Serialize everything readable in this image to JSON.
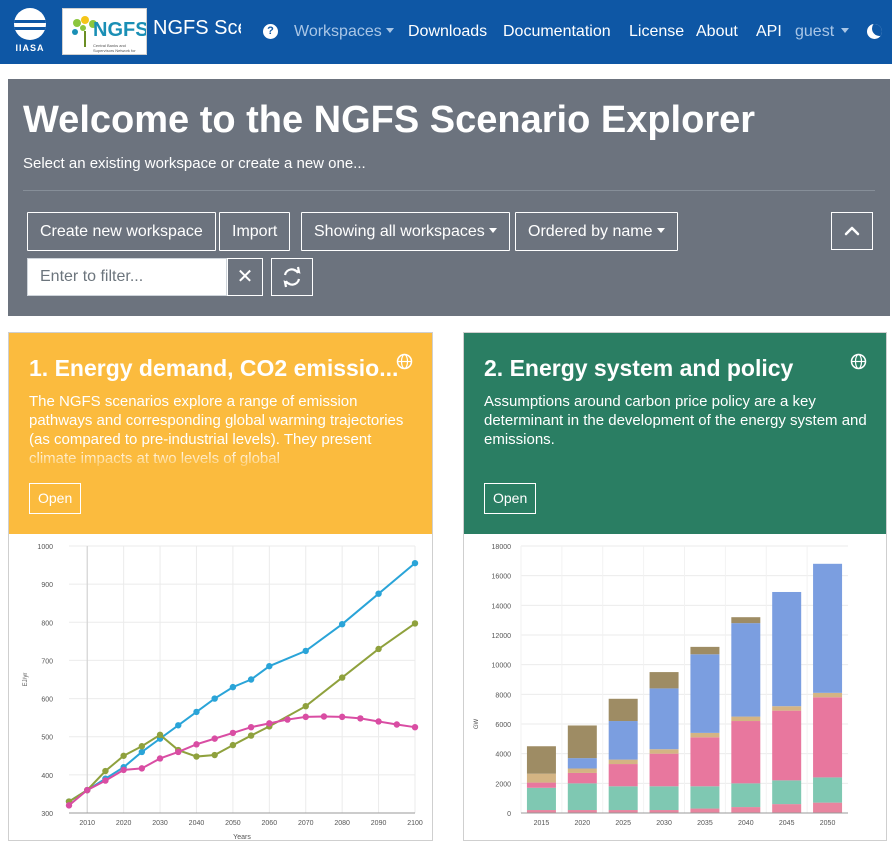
{
  "navbar": {
    "iiasa_logo_text": "IIASA",
    "ngfs_logo_text": "NGFS",
    "ngfs_logo_sub": "Central Banks and Supervisors Network for Greening the Financial System",
    "brand": "NGFS Scenario Explorer",
    "items": [
      {
        "label": "Workspaces",
        "muted": true,
        "dropdown": true
      },
      {
        "label": "Downloads"
      },
      {
        "label": "Documentation"
      },
      {
        "label": "License"
      },
      {
        "label": "About"
      },
      {
        "label": "API"
      },
      {
        "label": "guest",
        "muted": true,
        "dropdown": true
      }
    ],
    "help_icon": "question-circle-icon",
    "theme_icon": "moon-icon",
    "colors": {
      "background": "#0e57a5"
    }
  },
  "jumbotron": {
    "title": "Welcome to the NGFS Scenario Explorer",
    "lead": "Select an existing workspace or create a new one...",
    "buttons": {
      "create": "Create new workspace",
      "import": "Import",
      "showing": "Showing all workspaces",
      "ordered": "Ordered by name"
    },
    "filter_placeholder": "Enter to filter...",
    "colors": {
      "background": "#6c737e"
    }
  },
  "cards": [
    {
      "title": "1. Energy demand, CO2 emissio...",
      "description": "The NGFS scenarios explore a range of emission pathways and corresponding global warming trajectories (as compared to pre-industrial levels). They present climate impacts at two levels of global",
      "open_label": "Open",
      "color": "#fbbb3e"
    },
    {
      "title": "2. Energy system and policy",
      "description": "Assumptions around carbon price policy are a key determinant in the development of the energy system and emissions.",
      "open_label": "Open",
      "color": "#2a7e63"
    }
  ],
  "chart_data": [
    {
      "type": "line",
      "xlabel": "Years",
      "ylabel": "EJ/yr",
      "ylim": [
        300,
        1000
      ],
      "xlim": [
        2005,
        2100
      ],
      "y_ticks": [
        300,
        400,
        500,
        600,
        700,
        800,
        900,
        1000
      ],
      "x_ticks": [
        2010,
        2020,
        2030,
        2040,
        2050,
        2060,
        2070,
        2080,
        2090,
        2100
      ],
      "grid": true,
      "series": [
        {
          "color": "#2aa4d8",
          "x": [
            2005,
            2010,
            2015,
            2020,
            2025,
            2030,
            2035,
            2040,
            2045,
            2050,
            2055,
            2060,
            2070,
            2080,
            2090,
            2100
          ],
          "y": [
            330,
            360,
            390,
            420,
            460,
            495,
            530,
            565,
            600,
            630,
            650,
            685,
            725,
            795,
            875,
            955
          ]
        },
        {
          "color": "#8fa13d",
          "x": [
            2005,
            2010,
            2015,
            2020,
            2025,
            2030,
            2035,
            2040,
            2045,
            2050,
            2055,
            2060,
            2070,
            2080,
            2090,
            2100
          ],
          "y": [
            330,
            360,
            410,
            450,
            475,
            505,
            465,
            448,
            452,
            478,
            503,
            527,
            580,
            655,
            730,
            797
          ]
        },
        {
          "color": "#d94da3",
          "x": [
            2005,
            2010,
            2015,
            2020,
            2025,
            2030,
            2035,
            2040,
            2045,
            2050,
            2055,
            2060,
            2065,
            2070,
            2075,
            2080,
            2085,
            2090,
            2095,
            2100
          ],
          "y": [
            320,
            360,
            385,
            413,
            417,
            443,
            460,
            480,
            495,
            510,
            525,
            535,
            545,
            552,
            553,
            552,
            548,
            540,
            532,
            525
          ]
        }
      ]
    },
    {
      "type": "bar",
      "stacked": true,
      "xlabel": "",
      "ylabel": "GW",
      "ylim": [
        0,
        18000
      ],
      "y_ticks": [
        0,
        2000,
        4000,
        6000,
        8000,
        10000,
        12000,
        14000,
        16000,
        18000
      ],
      "categories": [
        "2015",
        "2020",
        "2025",
        "2030",
        "2035",
        "2040",
        "2045",
        "2050"
      ],
      "grid": true,
      "series": [
        {
          "color": "#e8859f",
          "values": [
            200,
            200,
            200,
            200,
            300,
            400,
            600,
            700
          ]
        },
        {
          "color": "#7fc8b2",
          "values": [
            1500,
            1800,
            1600,
            1600,
            1500,
            1600,
            1600,
            1700
          ]
        },
        {
          "color": "#e8779e",
          "values": [
            350,
            700,
            1500,
            2200,
            3300,
            4200,
            4700,
            5400
          ]
        },
        {
          "color": "#d4b483",
          "values": [
            600,
            300,
            300,
            300,
            300,
            300,
            300,
            300
          ]
        },
        {
          "color": "#7b9ee0",
          "values": [
            0,
            700,
            2600,
            4100,
            5300,
            6300,
            7700,
            8700
          ]
        },
        {
          "color": "#9e8c64",
          "values": [
            1850,
            2200,
            1500,
            1100,
            500,
            400,
            0,
            0
          ]
        }
      ]
    }
  ]
}
